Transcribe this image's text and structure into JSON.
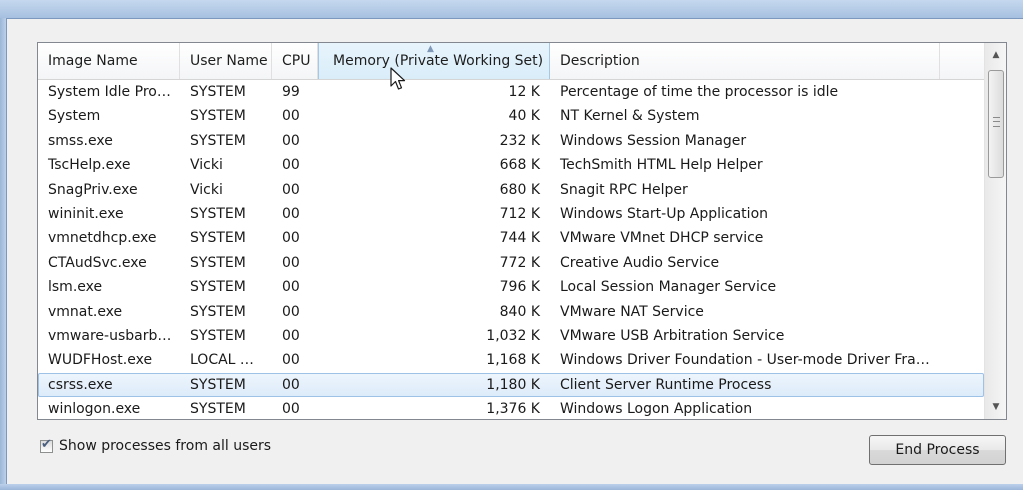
{
  "list": {
    "columns": {
      "image_name": "Image Name",
      "user_name": "User Name",
      "cpu": "CPU",
      "memory": "Memory (Private Working Set)",
      "description": "Description"
    },
    "sorted_column": "memory",
    "sort_direction": "ascending",
    "selected_row": 12,
    "rows": [
      {
        "name": "System Idle Pro…",
        "user": "SYSTEM",
        "cpu": "99",
        "mem": "12 K",
        "desc": "Percentage of time the processor is idle"
      },
      {
        "name": "System",
        "user": "SYSTEM",
        "cpu": "00",
        "mem": "40 K",
        "desc": "NT Kernel & System"
      },
      {
        "name": "smss.exe",
        "user": "SYSTEM",
        "cpu": "00",
        "mem": "232 K",
        "desc": "Windows Session Manager"
      },
      {
        "name": "TscHelp.exe",
        "user": "Vicki",
        "cpu": "00",
        "mem": "668 K",
        "desc": "TechSmith HTML Help Helper"
      },
      {
        "name": "SnagPriv.exe",
        "user": "Vicki",
        "cpu": "00",
        "mem": "680 K",
        "desc": "Snagit RPC Helper"
      },
      {
        "name": "wininit.exe",
        "user": "SYSTEM",
        "cpu": "00",
        "mem": "712 K",
        "desc": "Windows Start-Up Application"
      },
      {
        "name": "vmnetdhcp.exe",
        "user": "SYSTEM",
        "cpu": "00",
        "mem": "744 K",
        "desc": "VMware VMnet DHCP service"
      },
      {
        "name": "CTAudSvc.exe",
        "user": "SYSTEM",
        "cpu": "00",
        "mem": "772 K",
        "desc": "Creative Audio Service"
      },
      {
        "name": "lsm.exe",
        "user": "SYSTEM",
        "cpu": "00",
        "mem": "796 K",
        "desc": "Local Session Manager Service"
      },
      {
        "name": "vmnat.exe",
        "user": "SYSTEM",
        "cpu": "00",
        "mem": "840 K",
        "desc": "VMware NAT Service"
      },
      {
        "name": "vmware-usbarb…",
        "user": "SYSTEM",
        "cpu": "00",
        "mem": "1,032 K",
        "desc": "VMware USB Arbitration Service"
      },
      {
        "name": "WUDFHost.exe",
        "user": "LOCAL …",
        "cpu": "00",
        "mem": "1,168 K",
        "desc": "Windows Driver Foundation - User-mode Driver Fra…"
      },
      {
        "name": "csrss.exe",
        "user": "SYSTEM",
        "cpu": "00",
        "mem": "1,180 K",
        "desc": "Client Server Runtime Process"
      },
      {
        "name": "winlogon.exe",
        "user": "SYSTEM",
        "cpu": "00",
        "mem": "1,376 K",
        "desc": "Windows Logon Application"
      }
    ]
  },
  "footer": {
    "show_all_users_label": "Show processes from all users",
    "show_all_users_checked": true,
    "end_process_label": "End Process"
  },
  "icons": {
    "sort": "sort-ascending-icon",
    "scroll_up": "scroll-up-icon",
    "scroll_down": "scroll-down-icon",
    "cursor": "mouse-pointer-icon",
    "check": "checkmark-icon"
  }
}
